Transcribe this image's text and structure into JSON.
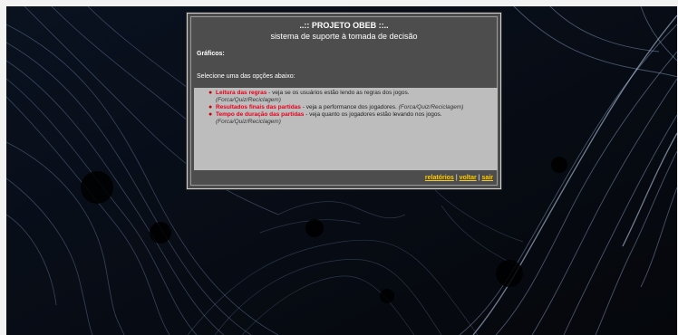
{
  "header": {
    "title": "..:: PROJETO OBEB ::..",
    "subtitle": "sistema de suporte à tomada de decisão"
  },
  "section": {
    "title": "Gráficos:",
    "instruction": "Selecione uma das opções abaixo:"
  },
  "options": [
    {
      "link": "Leitura das regras",
      "desc": " - veja se os usuários estão lendo as regras dos jogos.",
      "sub": "(Forca/Quiz/Reciclagem)"
    },
    {
      "link": "Resultados finais das partidas",
      "desc": " - veja a performance dos jogadores. ",
      "sub": "(Forca/Quiz/Reciclagem)"
    },
    {
      "link": "Tempo de duração das partidas",
      "desc": " - veja quanto os jogadores estão levando nos jogos.",
      "sub": "(Forca/Quiz/Reciclagem)"
    }
  ],
  "footer": {
    "relatorios": "relatórios",
    "voltar": "voltar",
    "sair": "sair",
    "separator": "|"
  },
  "colors": {
    "panel_bg": "#4d4d4d",
    "options_bg": "#bdbdbd",
    "link_red": "#e8001c",
    "footer_link": "#ffcc00"
  }
}
